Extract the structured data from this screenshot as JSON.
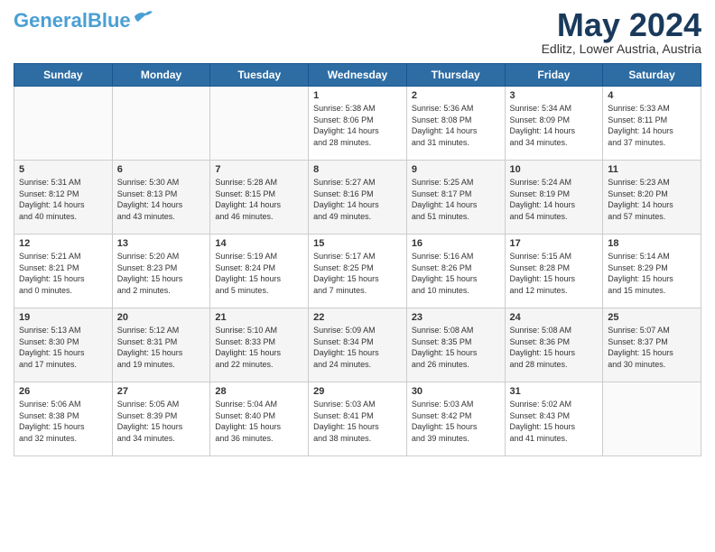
{
  "header": {
    "logo_line1": "General",
    "logo_line2": "Blue",
    "month": "May 2024",
    "location": "Edlitz, Lower Austria, Austria"
  },
  "days_of_week": [
    "Sunday",
    "Monday",
    "Tuesday",
    "Wednesday",
    "Thursday",
    "Friday",
    "Saturday"
  ],
  "weeks": [
    [
      {
        "day": "",
        "info": ""
      },
      {
        "day": "",
        "info": ""
      },
      {
        "day": "",
        "info": ""
      },
      {
        "day": "1",
        "info": "Sunrise: 5:38 AM\nSunset: 8:06 PM\nDaylight: 14 hours\nand 28 minutes."
      },
      {
        "day": "2",
        "info": "Sunrise: 5:36 AM\nSunset: 8:08 PM\nDaylight: 14 hours\nand 31 minutes."
      },
      {
        "day": "3",
        "info": "Sunrise: 5:34 AM\nSunset: 8:09 PM\nDaylight: 14 hours\nand 34 minutes."
      },
      {
        "day": "4",
        "info": "Sunrise: 5:33 AM\nSunset: 8:11 PM\nDaylight: 14 hours\nand 37 minutes."
      }
    ],
    [
      {
        "day": "5",
        "info": "Sunrise: 5:31 AM\nSunset: 8:12 PM\nDaylight: 14 hours\nand 40 minutes."
      },
      {
        "day": "6",
        "info": "Sunrise: 5:30 AM\nSunset: 8:13 PM\nDaylight: 14 hours\nand 43 minutes."
      },
      {
        "day": "7",
        "info": "Sunrise: 5:28 AM\nSunset: 8:15 PM\nDaylight: 14 hours\nand 46 minutes."
      },
      {
        "day": "8",
        "info": "Sunrise: 5:27 AM\nSunset: 8:16 PM\nDaylight: 14 hours\nand 49 minutes."
      },
      {
        "day": "9",
        "info": "Sunrise: 5:25 AM\nSunset: 8:17 PM\nDaylight: 14 hours\nand 51 minutes."
      },
      {
        "day": "10",
        "info": "Sunrise: 5:24 AM\nSunset: 8:19 PM\nDaylight: 14 hours\nand 54 minutes."
      },
      {
        "day": "11",
        "info": "Sunrise: 5:23 AM\nSunset: 8:20 PM\nDaylight: 14 hours\nand 57 minutes."
      }
    ],
    [
      {
        "day": "12",
        "info": "Sunrise: 5:21 AM\nSunset: 8:21 PM\nDaylight: 15 hours\nand 0 minutes."
      },
      {
        "day": "13",
        "info": "Sunrise: 5:20 AM\nSunset: 8:23 PM\nDaylight: 15 hours\nand 2 minutes."
      },
      {
        "day": "14",
        "info": "Sunrise: 5:19 AM\nSunset: 8:24 PM\nDaylight: 15 hours\nand 5 minutes."
      },
      {
        "day": "15",
        "info": "Sunrise: 5:17 AM\nSunset: 8:25 PM\nDaylight: 15 hours\nand 7 minutes."
      },
      {
        "day": "16",
        "info": "Sunrise: 5:16 AM\nSunset: 8:26 PM\nDaylight: 15 hours\nand 10 minutes."
      },
      {
        "day": "17",
        "info": "Sunrise: 5:15 AM\nSunset: 8:28 PM\nDaylight: 15 hours\nand 12 minutes."
      },
      {
        "day": "18",
        "info": "Sunrise: 5:14 AM\nSunset: 8:29 PM\nDaylight: 15 hours\nand 15 minutes."
      }
    ],
    [
      {
        "day": "19",
        "info": "Sunrise: 5:13 AM\nSunset: 8:30 PM\nDaylight: 15 hours\nand 17 minutes."
      },
      {
        "day": "20",
        "info": "Sunrise: 5:12 AM\nSunset: 8:31 PM\nDaylight: 15 hours\nand 19 minutes."
      },
      {
        "day": "21",
        "info": "Sunrise: 5:10 AM\nSunset: 8:33 PM\nDaylight: 15 hours\nand 22 minutes."
      },
      {
        "day": "22",
        "info": "Sunrise: 5:09 AM\nSunset: 8:34 PM\nDaylight: 15 hours\nand 24 minutes."
      },
      {
        "day": "23",
        "info": "Sunrise: 5:08 AM\nSunset: 8:35 PM\nDaylight: 15 hours\nand 26 minutes."
      },
      {
        "day": "24",
        "info": "Sunrise: 5:08 AM\nSunset: 8:36 PM\nDaylight: 15 hours\nand 28 minutes."
      },
      {
        "day": "25",
        "info": "Sunrise: 5:07 AM\nSunset: 8:37 PM\nDaylight: 15 hours\nand 30 minutes."
      }
    ],
    [
      {
        "day": "26",
        "info": "Sunrise: 5:06 AM\nSunset: 8:38 PM\nDaylight: 15 hours\nand 32 minutes."
      },
      {
        "day": "27",
        "info": "Sunrise: 5:05 AM\nSunset: 8:39 PM\nDaylight: 15 hours\nand 34 minutes."
      },
      {
        "day": "28",
        "info": "Sunrise: 5:04 AM\nSunset: 8:40 PM\nDaylight: 15 hours\nand 36 minutes."
      },
      {
        "day": "29",
        "info": "Sunrise: 5:03 AM\nSunset: 8:41 PM\nDaylight: 15 hours\nand 38 minutes."
      },
      {
        "day": "30",
        "info": "Sunrise: 5:03 AM\nSunset: 8:42 PM\nDaylight: 15 hours\nand 39 minutes."
      },
      {
        "day": "31",
        "info": "Sunrise: 5:02 AM\nSunset: 8:43 PM\nDaylight: 15 hours\nand 41 minutes."
      },
      {
        "day": "",
        "info": ""
      }
    ]
  ]
}
